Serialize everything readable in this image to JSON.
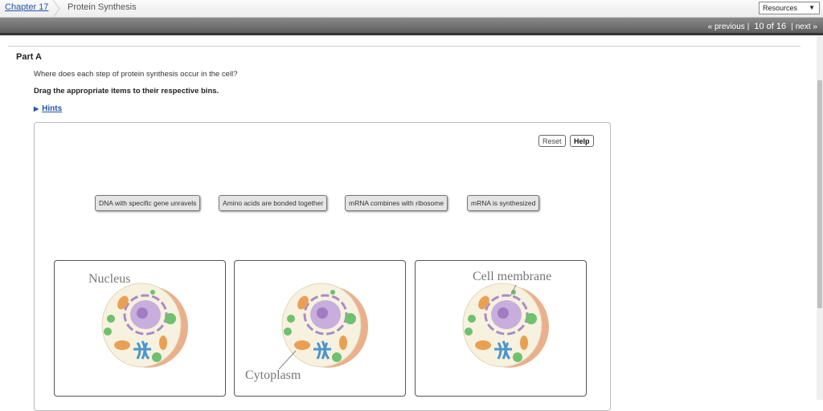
{
  "header": {
    "chapter": "Chapter 17",
    "title": "Protein Synthesis",
    "resources": "Resources"
  },
  "nav": {
    "previous": "« previous",
    "position": "10 of 16",
    "next": "next »"
  },
  "part": {
    "title": "Part A",
    "question": "Where does each step of protein synthesis occur in the cell?",
    "instruction": "Drag the appropriate items to their respective bins.",
    "hints": "Hints"
  },
  "controls": {
    "reset": "Reset",
    "help": "Help"
  },
  "items": [
    "DNA with specific gene unravels",
    "Amino acids are bonded together",
    "mRNA combines with ribosome",
    "mRNA is synthesized"
  ],
  "bins": [
    {
      "label": "Nucleus"
    },
    {
      "label": "Cytoplasm"
    },
    {
      "label": "Cell membrane"
    }
  ]
}
